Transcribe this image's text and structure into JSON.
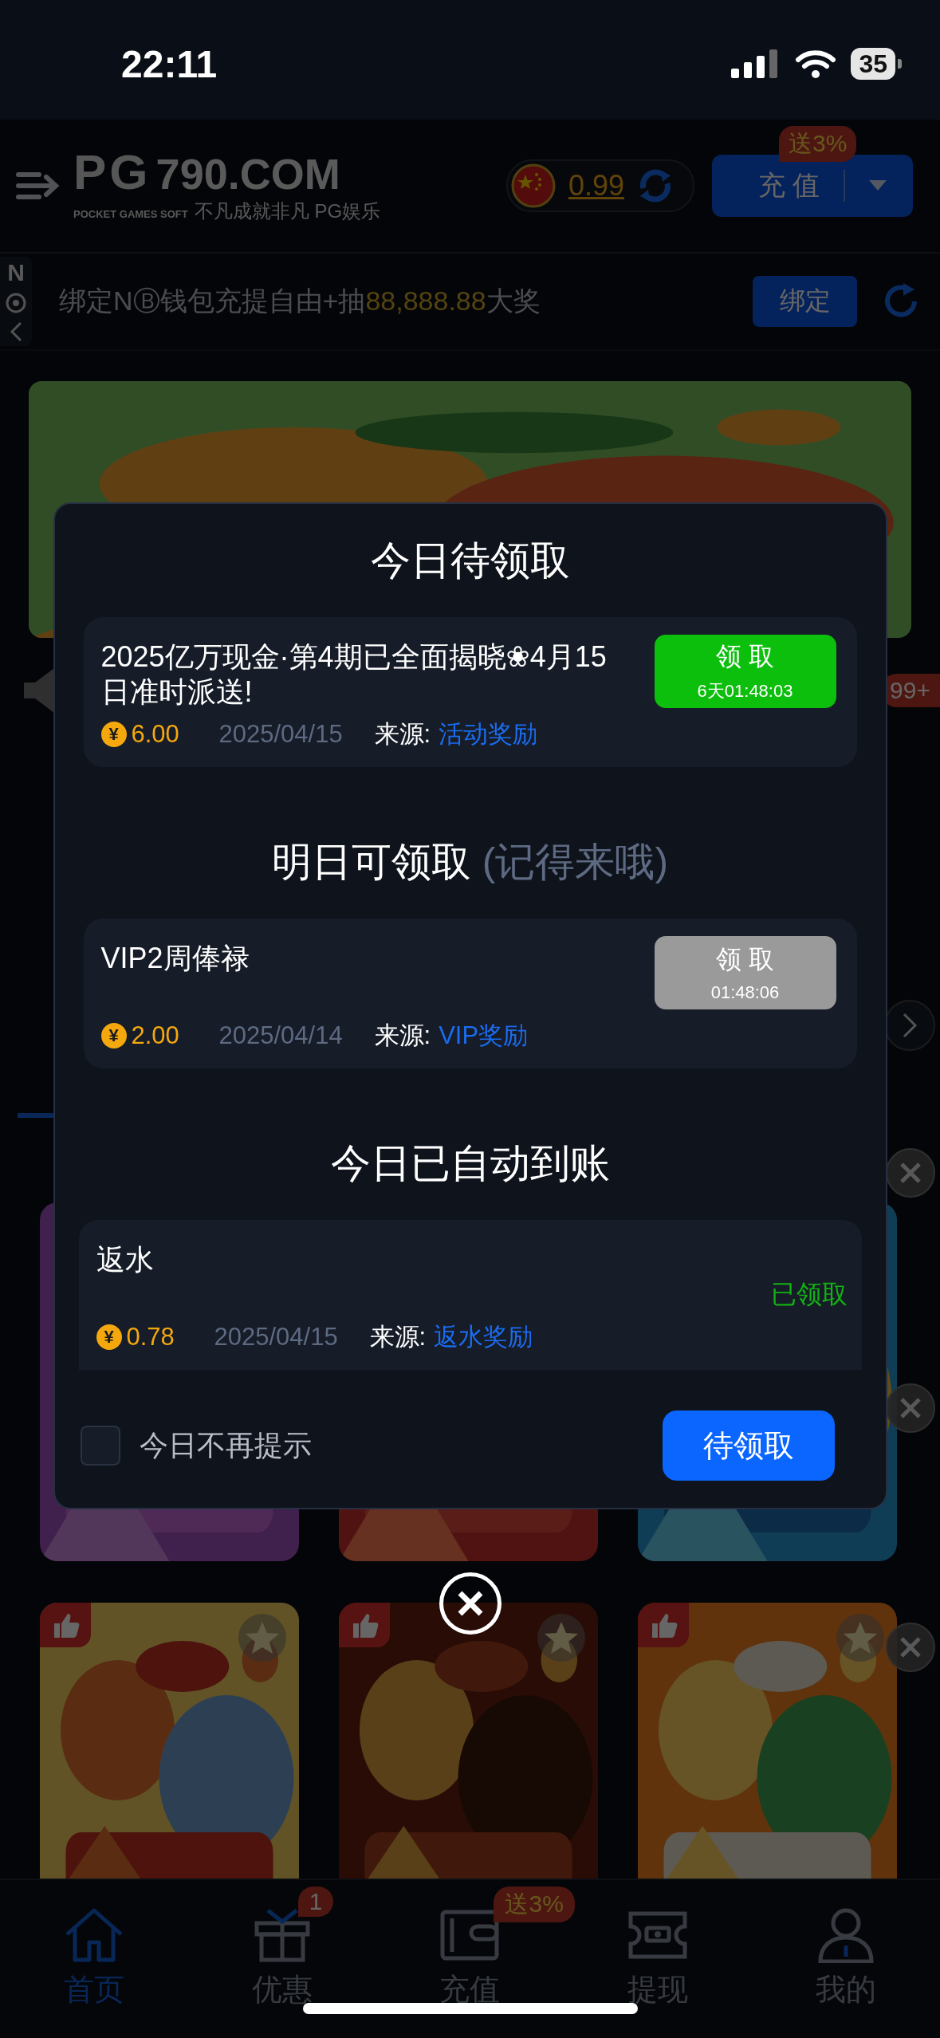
{
  "status_bar": {
    "time": "22:11",
    "battery": "35"
  },
  "header": {
    "logo_mark": "PG",
    "logo_domain": "790.COM",
    "logo_tagline": "POCKET GAMES SOFT",
    "slogan": "不凡成就非凡 PG娱乐",
    "balance": "0.99",
    "deposit_button": "充 值",
    "deposit_badge": "送3%"
  },
  "notice": {
    "side_tab": "N",
    "text_before": "绑定NⒷ钱包充提自由+抽",
    "highlight": "88,888.88",
    "text_after": "大奖",
    "bind_button": "绑定"
  },
  "unread_badge": "99+",
  "modal": {
    "sections": [
      {
        "title": "今日待领取",
        "items": [
          {
            "kind": "claim",
            "title": "2025亿万现金·第4期已全面揭晓❀4月15日准时派送!",
            "action": "领 取",
            "countdown": "6天01:48:03",
            "disabled": false,
            "coin": "¥",
            "amount": "6.00",
            "date": "2025/04/15",
            "source_label": "来源:",
            "source": "活动奖励"
          }
        ]
      },
      {
        "title": "明日可领取",
        "note": "(记得来哦)",
        "items": [
          {
            "kind": "claim",
            "title": "VIP2周俸禄",
            "action": "领 取",
            "countdown": "01:48:06",
            "disabled": true,
            "coin": "¥",
            "amount": "2.00",
            "date": "2025/04/14",
            "source_label": "来源:",
            "source": "VIP奖励"
          }
        ]
      },
      {
        "title": "今日已自动到账",
        "items": [
          {
            "kind": "status",
            "title": "返水",
            "status": "已领取",
            "coin": "¥",
            "amount": "0.78",
            "date": "2025/04/15",
            "source_label": "来源:",
            "source": "返水奖励"
          }
        ]
      }
    ],
    "footer": {
      "checkbox_label": "今日不再提示",
      "checked": false,
      "button": "待领取"
    }
  },
  "tab_bar": {
    "items": [
      {
        "label": "首页",
        "selected": true
      },
      {
        "label": "优惠",
        "selected": false,
        "badge": "1"
      },
      {
        "label": "充值",
        "selected": false,
        "badge": "送3%"
      },
      {
        "label": "提现",
        "selected": false
      },
      {
        "label": "我的",
        "selected": false
      }
    ]
  }
}
